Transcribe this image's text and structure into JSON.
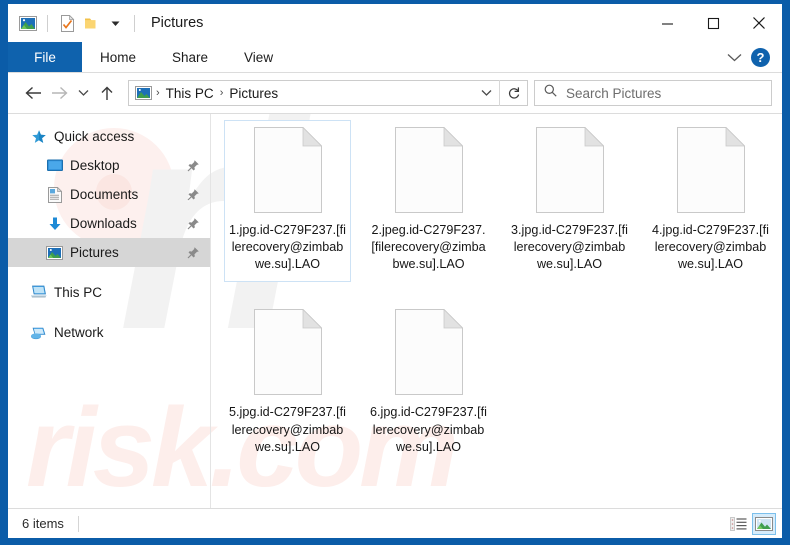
{
  "window": {
    "title": "Pictures",
    "accent_color": "#0f62ad",
    "border_color": "#0b5ca8"
  },
  "quick_access_toolbar": {
    "items": [
      {
        "name": "pictures-folder-icon",
        "label": "Pictures"
      },
      {
        "name": "properties-icon",
        "label": "Properties"
      },
      {
        "name": "new-folder-icon",
        "label": "New folder"
      },
      {
        "name": "customize-qat-icon",
        "label": "Customize Quick Access Toolbar"
      }
    ]
  },
  "window_controls": {
    "minimize": "Minimize",
    "maximize": "Maximize",
    "close": "Close"
  },
  "ribbon": {
    "tabs": [
      {
        "label": "File",
        "active": true
      },
      {
        "label": "Home",
        "active": false
      },
      {
        "label": "Share",
        "active": false
      },
      {
        "label": "View",
        "active": false
      }
    ],
    "expand_label": "Expand the Ribbon",
    "help_label": "?"
  },
  "address_bar": {
    "back": "Back",
    "forward": "Forward",
    "recent": "Recent locations",
    "up": "Up",
    "breadcrumbs": [
      "This PC",
      "Pictures"
    ],
    "separator": "›",
    "dropdown": "Previous locations",
    "refresh": "Refresh"
  },
  "search": {
    "placeholder": "Search Pictures",
    "icon": "search-icon"
  },
  "sidebar": {
    "items": [
      {
        "label": "Quick access",
        "icon": "star-icon",
        "indent": false,
        "pinned": false,
        "selected": false,
        "gap": false
      },
      {
        "label": "Desktop",
        "icon": "desktop-icon",
        "indent": true,
        "pinned": true,
        "selected": false,
        "gap": false
      },
      {
        "label": "Documents",
        "icon": "documents-icon",
        "indent": true,
        "pinned": true,
        "selected": false,
        "gap": false
      },
      {
        "label": "Downloads",
        "icon": "downloads-icon",
        "indent": true,
        "pinned": true,
        "selected": false,
        "gap": false
      },
      {
        "label": "Pictures",
        "icon": "pictures-icon",
        "indent": true,
        "pinned": true,
        "selected": true,
        "gap": false
      },
      {
        "label": "This PC",
        "icon": "this-pc-icon",
        "indent": false,
        "pinned": false,
        "selected": false,
        "gap": true
      },
      {
        "label": "Network",
        "icon": "network-icon",
        "indent": false,
        "pinned": false,
        "selected": false,
        "gap": true
      }
    ]
  },
  "files": [
    {
      "name": "1.jpg.id-C279F237.[filerecovery@zimbabwe.su].LAO",
      "selected": true
    },
    {
      "name": "2.jpeg.id-C279F237.[filerecovery@zimbabwe.su].LAO",
      "selected": false
    },
    {
      "name": "3.jpg.id-C279F237.[filerecovery@zimbabwe.su].LAO",
      "selected": false
    },
    {
      "name": "4.jpg.id-C279F237.[filerecovery@zimbabwe.su].LAO",
      "selected": false
    },
    {
      "name": "5.jpg.id-C279F237.[filerecovery@zimbabwe.su].LAO",
      "selected": false
    },
    {
      "name": "6.jpg.id-C279F237.[filerecovery@zimbabwe.su].LAO",
      "selected": false
    }
  ],
  "status_bar": {
    "item_count_text": "6 items",
    "view_buttons": [
      {
        "name": "details-view-button",
        "label": "Details view",
        "active": false
      },
      {
        "name": "large-icons-view-button",
        "label": "Large icons view",
        "active": true
      }
    ]
  },
  "watermark": {
    "logo_text": "rl",
    "bottom_text": "risk.com"
  }
}
